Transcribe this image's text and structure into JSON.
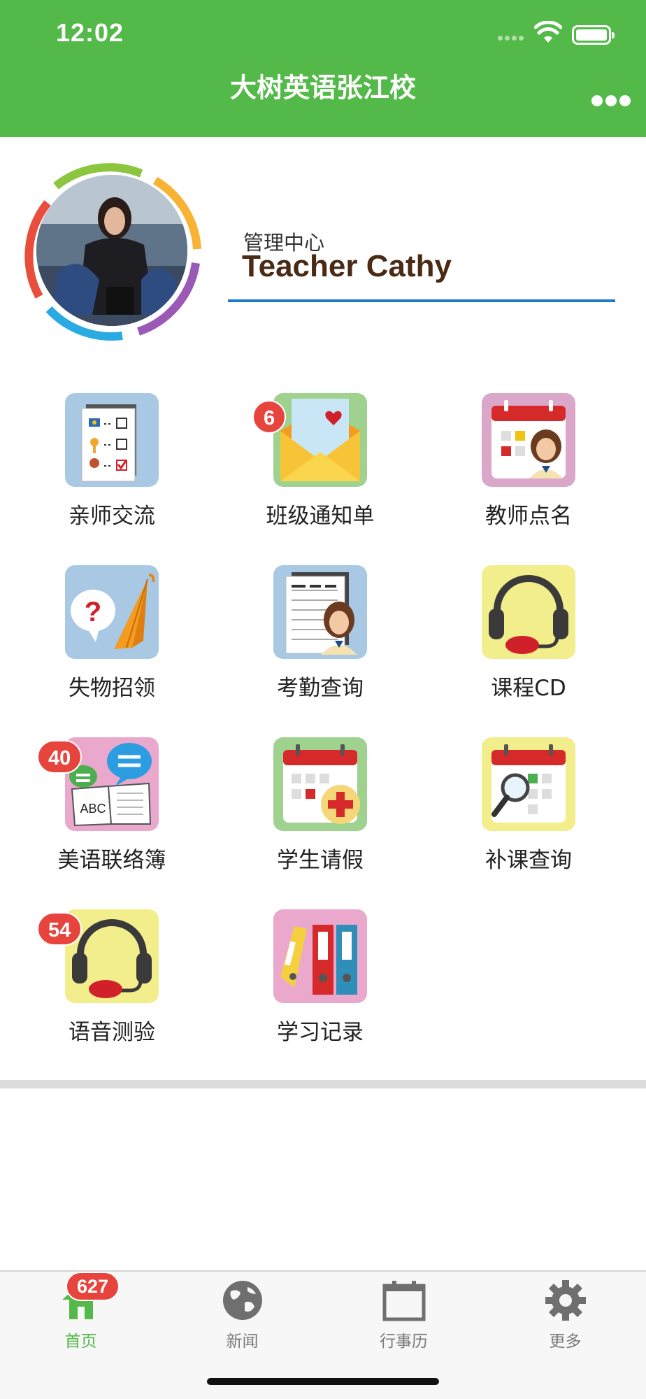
{
  "status_bar": {
    "time": "12:02"
  },
  "header": {
    "title": "大树英语张江校",
    "more_icon": "more-dots-icon"
  },
  "profile": {
    "subtitle": "管理中心",
    "name": "Teacher Cathy"
  },
  "menu": [
    {
      "label": "亲师交流",
      "icon": "checklist-icon",
      "badge": null
    },
    {
      "label": "班级通知单",
      "icon": "envelope-icon",
      "badge": "6"
    },
    {
      "label": "教师点名",
      "icon": "calendar-teacher-icon",
      "badge": null
    },
    {
      "label": "失物招领",
      "icon": "umbrella-question-icon",
      "badge": null
    },
    {
      "label": "考勤查询",
      "icon": "attendance-sheet-icon",
      "badge": null
    },
    {
      "label": "课程CD",
      "icon": "headphones-icon",
      "badge": null
    },
    {
      "label": "美语联络簿",
      "icon": "book-chat-icon",
      "badge": "40"
    },
    {
      "label": "学生请假",
      "icon": "calendar-cross-icon",
      "badge": null
    },
    {
      "label": "补课查询",
      "icon": "calendar-search-icon",
      "badge": null
    },
    {
      "label": "语音测验",
      "icon": "headset-icon",
      "badge": "54"
    },
    {
      "label": "学习记录",
      "icon": "binders-icon",
      "badge": null
    }
  ],
  "tabbar": [
    {
      "label": "首页",
      "icon": "home-icon",
      "badge": "627",
      "active": true
    },
    {
      "label": "新闻",
      "icon": "globe-icon",
      "badge": null,
      "active": false
    },
    {
      "label": "行事历",
      "icon": "calendar-icon",
      "badge": null,
      "active": false
    },
    {
      "label": "更多",
      "icon": "gear-icon",
      "badge": null,
      "active": false
    }
  ],
  "colors": {
    "brand_green": "#53b948",
    "badge_red": "#e8443e",
    "accent_blue": "#1f7ac9",
    "name_brown": "#4a2a14"
  }
}
